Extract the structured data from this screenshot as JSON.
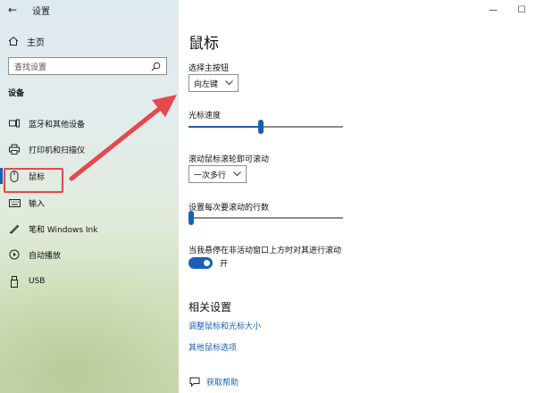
{
  "window": {
    "title": "设置",
    "back_glyph": "←",
    "minimize_glyph": "—",
    "maximize_glyph": "☐"
  },
  "sidebar": {
    "home_label": "主页",
    "search_placeholder": "查找设置",
    "section_label": "设备",
    "items": [
      {
        "label": "蓝牙和其他设备",
        "icon": "bluetooth-devices-icon"
      },
      {
        "label": "打印机和扫描仪",
        "icon": "printer-icon"
      },
      {
        "label": "鼠标",
        "icon": "mouse-icon",
        "active": true
      },
      {
        "label": "输入",
        "icon": "keyboard-icon"
      },
      {
        "label": "笔和 Windows Ink",
        "icon": "pen-icon"
      },
      {
        "label": "自动播放",
        "icon": "autoplay-icon"
      },
      {
        "label": "USB",
        "icon": "usb-icon"
      }
    ]
  },
  "main": {
    "title": "鼠标",
    "primary_button": {
      "label": "选择主按钮",
      "value": "向左键"
    },
    "cursor_speed": {
      "label": "光标速度",
      "value_fraction": 0.47
    },
    "wheel_scroll": {
      "label": "滚动鼠标滚轮即可滚动",
      "value": "一次多行"
    },
    "lines_per_scroll": {
      "label": "设置每次要滚动的行数",
      "value_fraction": 0.02
    },
    "inactive_scroll": {
      "label": "当我悬停在非活动窗口上方时对其进行滚动",
      "state": "开",
      "on": true
    },
    "related": {
      "title": "相关设置",
      "links": [
        "调整鼠标和光标大小",
        "其他鼠标选项"
      ]
    },
    "help_label": "获取帮助"
  },
  "colors": {
    "accent": "#1a5fb4",
    "annotation": "#e5484d"
  }
}
